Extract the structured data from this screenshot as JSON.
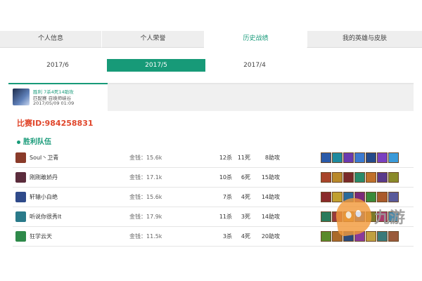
{
  "tabs": [
    {
      "label": "个人信息",
      "active": false
    },
    {
      "label": "个人荣誉",
      "active": false
    },
    {
      "label": "历史战绩",
      "active": true
    },
    {
      "label": "我的英雄与皮肤",
      "active": false
    }
  ],
  "months": [
    {
      "label": "2017/6",
      "active": false
    },
    {
      "label": "2017/5",
      "active": true
    },
    {
      "label": "2017/4",
      "active": false
    }
  ],
  "match": {
    "result_line": "胜利 7杀4死14助攻",
    "mode_line": "匹配赛 召唤师峡谷",
    "time_line": "2017/05/09 01:09"
  },
  "match_id": "比赛ID:984258831",
  "team_title": "胜利队伍",
  "players": [
    {
      "name": "Soul丶卫青",
      "gold": "金钱：15.6k",
      "kills": "12杀",
      "deaths": "11死",
      "assists": "8助攻",
      "avatar_color": "#8a3b2a"
    },
    {
      "name": "刚刚敢娇丹",
      "gold": "金钱：17.1k",
      "kills": "10杀",
      "deaths": "6死",
      "assists": "15助攻",
      "avatar_color": "#5b2c3c"
    },
    {
      "name": "轩辕小白绝",
      "gold": "金钱：15.6k",
      "kills": "7杀",
      "deaths": "4死",
      "assists": "14助攻",
      "avatar_color": "#2f4a8a"
    },
    {
      "name": "听说你很秀lt",
      "gold": "金钱：17.9k",
      "kills": "11杀",
      "deaths": "3死",
      "assists": "14助攻",
      "avatar_color": "#2a7a8a"
    },
    {
      "name": "狂学云天",
      "gold": "金钱：11.5k",
      "kills": "3杀",
      "deaths": "4死",
      "assists": "20助攻",
      "avatar_color": "#2e8a4a"
    }
  ],
  "item_colors": [
    [
      "#2a5aa8",
      "#1f8a9e",
      "#6a3ab0",
      "#3b7ad0",
      "#254a8a",
      "#7a40c0",
      "#3a9ad8"
    ],
    [
      "#a8442a",
      "#b8892a",
      "#7a2a2a",
      "#2a8a6a",
      "#c0702a",
      "#5a3a8a",
      "#8a8a2a"
    ],
    [
      "#8a2a2a",
      "#c0a030",
      "#2a6a9a",
      "#7a2a7a",
      "#3a8a3a",
      "#aa5a2a",
      "#5a5a9a"
    ],
    [
      "#2a7a5a",
      "#9a3a3a",
      "#c08a2a",
      "#3a5aaa",
      "#7a7a2a",
      "#aa3a6a",
      "#4a8aaa"
    ],
    [
      "#5a8a2a",
      "#aa6a2a",
      "#2a4a7a",
      "#8a3a9a",
      "#c0a040",
      "#3a7a7a",
      "#9a5a3a"
    ]
  ],
  "watermark": {
    "text": "九游"
  },
  "accent_color": "#179a78",
  "match_id_color": "#e0462b"
}
